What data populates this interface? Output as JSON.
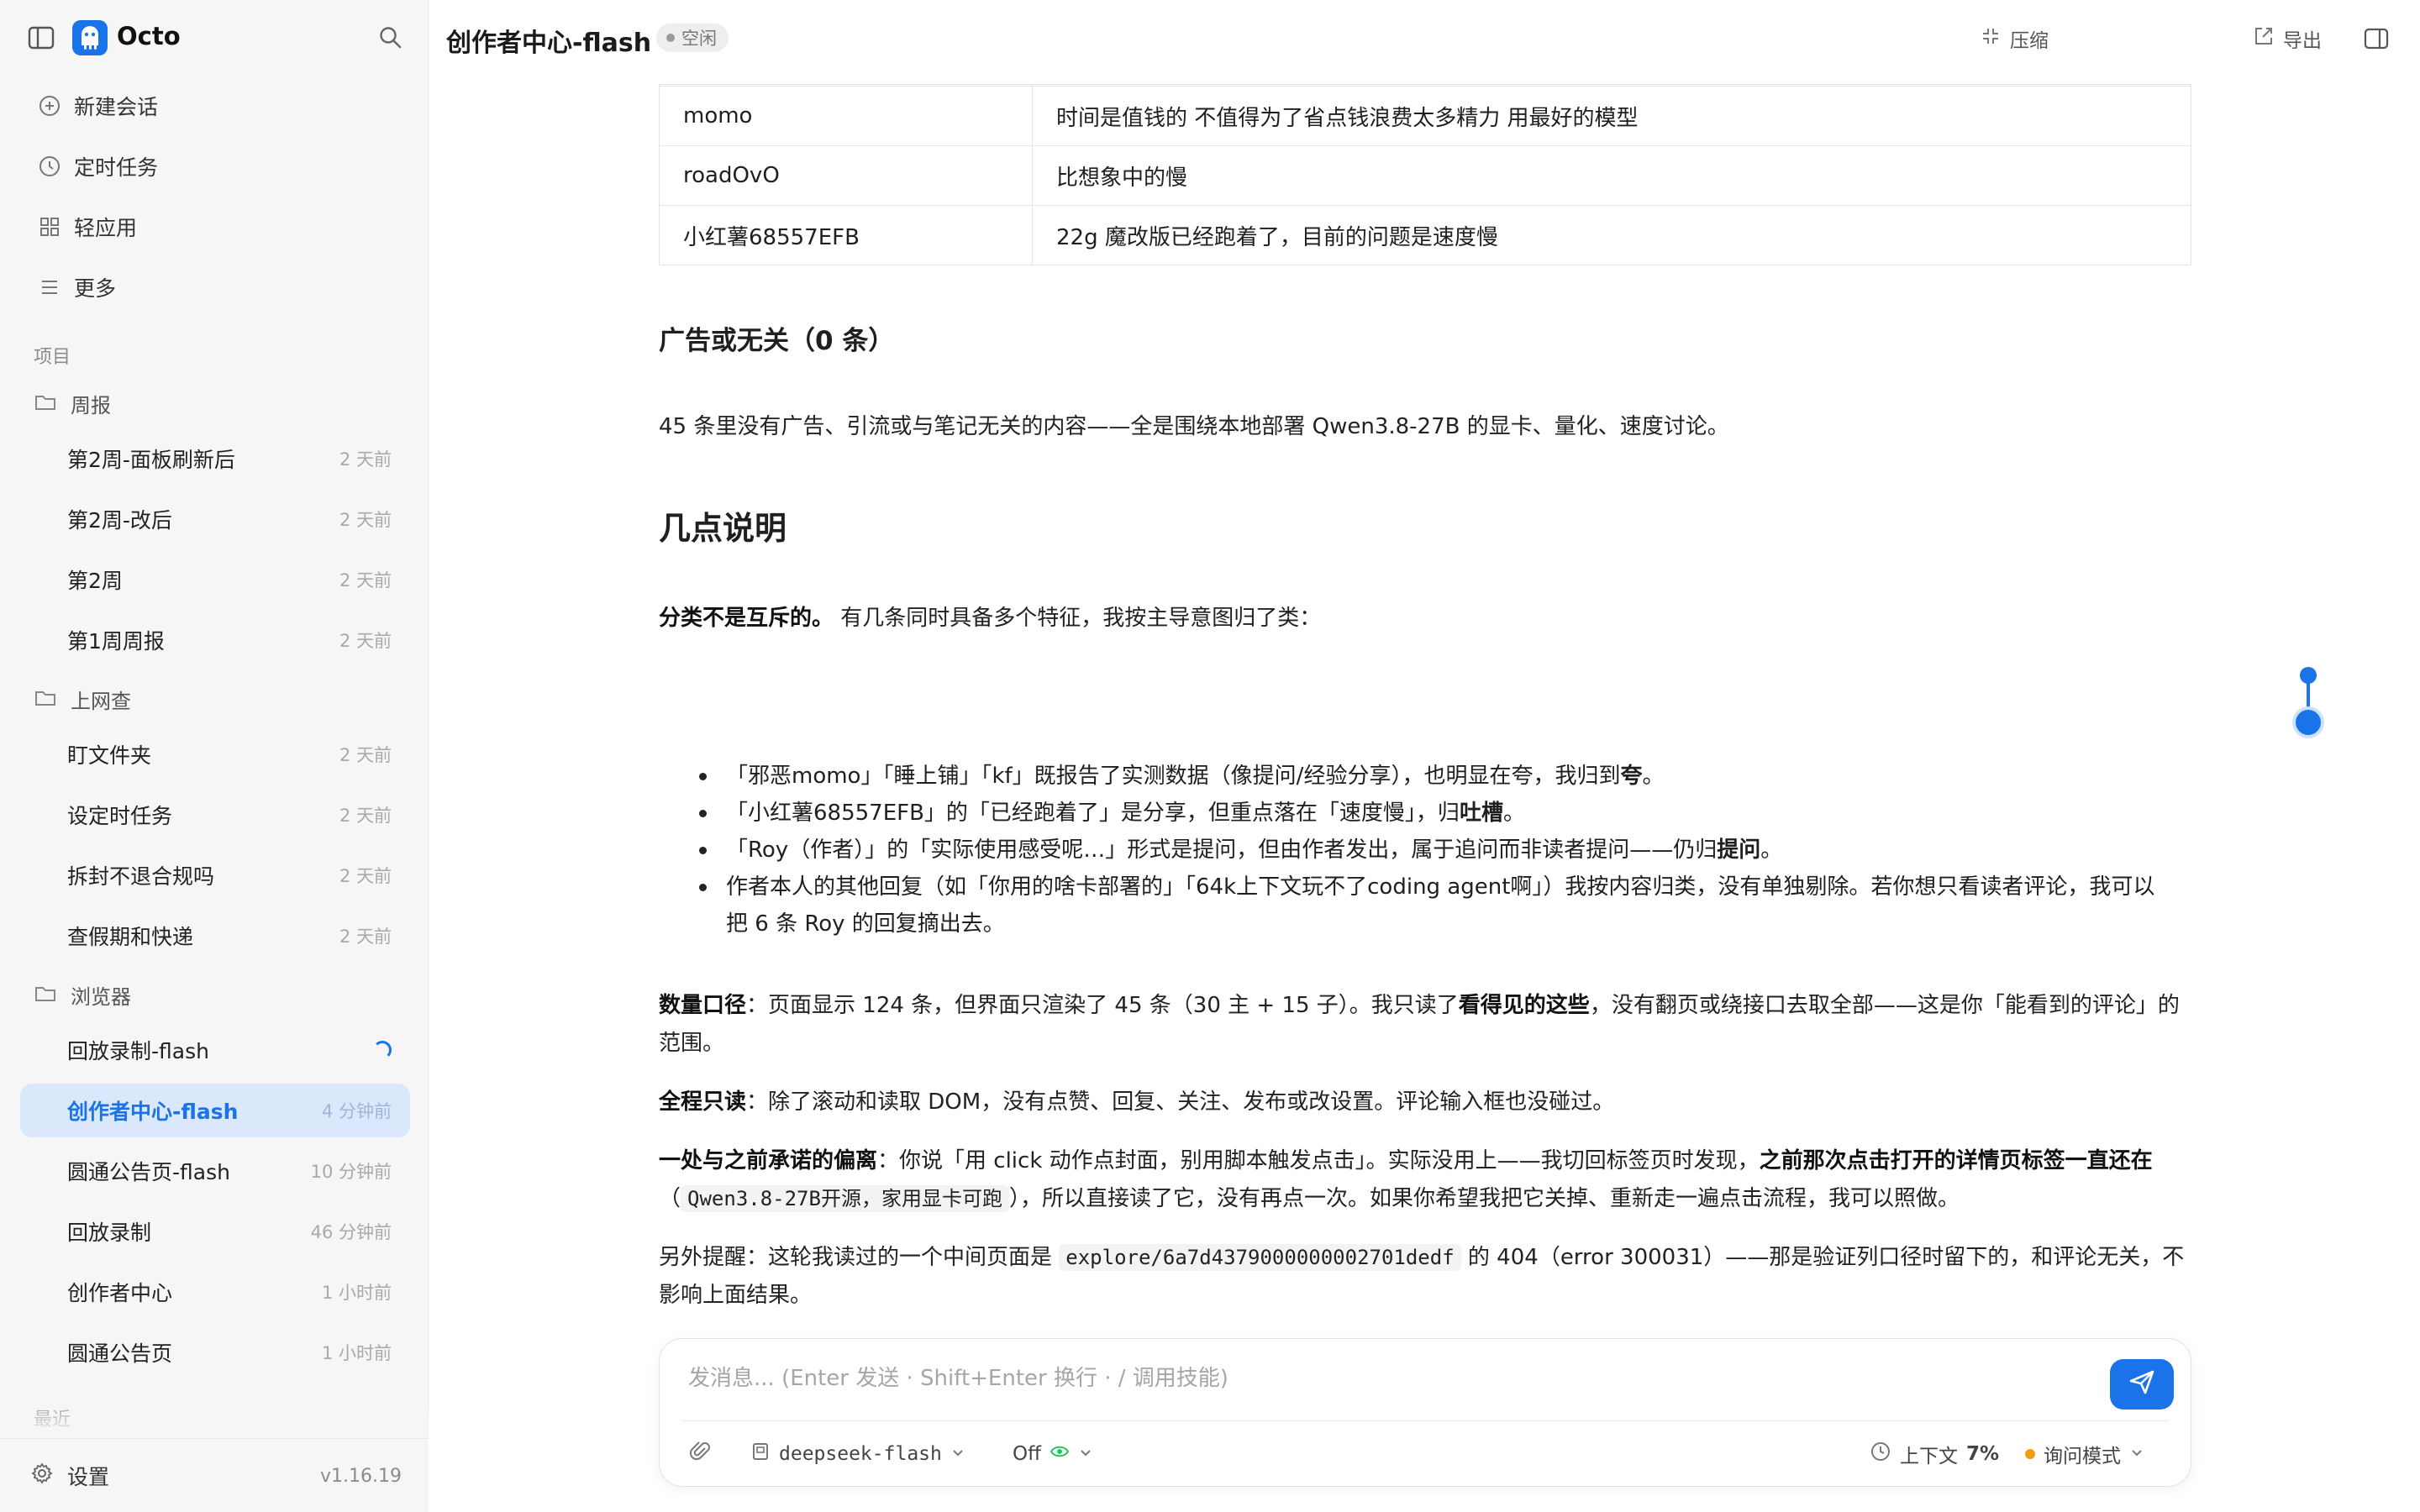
{
  "app": {
    "name": "Octo",
    "version": "v1.16.19"
  },
  "nav": [
    {
      "label": "新建会话",
      "icon": "plus-circle-icon"
    },
    {
      "label": "定时任务",
      "icon": "clock-icon"
    },
    {
      "label": "轻应用",
      "icon": "grid-icon"
    },
    {
      "label": "更多",
      "icon": "menu-icon"
    }
  ],
  "sidebar": {
    "section_label": "项目",
    "groups": [
      {
        "name": "周报",
        "sessions": [
          {
            "title": "第2周-面板刷新后",
            "time": "2 天前"
          },
          {
            "title": "第2周-改后",
            "time": "2 天前"
          },
          {
            "title": "第2周",
            "time": "2 天前"
          },
          {
            "title": "第1周周报",
            "time": "2 天前"
          }
        ]
      },
      {
        "name": "上网查",
        "sessions": [
          {
            "title": "盯文件夹",
            "time": "2 天前"
          },
          {
            "title": "设定时任务",
            "time": "2 天前"
          },
          {
            "title": "拆封不退合规吗",
            "time": "2 天前"
          },
          {
            "title": "查假期和快递",
            "time": "2 天前"
          }
        ]
      },
      {
        "name": "浏览器",
        "sessions": [
          {
            "title": "回放录制-flash",
            "time": ""
          },
          {
            "title": "创作者中心-flash",
            "time": "4 分钟前"
          },
          {
            "title": "圆通公告页-flash",
            "time": "10 分钟前"
          },
          {
            "title": "回放录制",
            "time": "46 分钟前"
          },
          {
            "title": "创作者中心",
            "time": "1 小时前"
          },
          {
            "title": "圆通公告页",
            "time": "1 小时前"
          }
        ]
      }
    ],
    "next_section_partial": "最近",
    "settings_label": "设置"
  },
  "header": {
    "title": "创作者中心-flash",
    "status": "空闲",
    "compress_label": "压缩",
    "export_label": "导出"
  },
  "content": {
    "table_rows": [
      {
        "user": "momo",
        "comment": "时间是值钱的 不值得为了省点钱浪费太多精力 用最好的模型"
      },
      {
        "user": "roadOvO",
        "comment": "比想象中的慢"
      },
      {
        "user": "小红薯68557EFB",
        "comment": "22g 魔改版已经跑着了，目前的问题是速度慢"
      }
    ],
    "ads_heading": "广告或无关（0 条）",
    "ads_text": "45 条里没有广告、引流或与笔记无关的内容——全是围绕本地部署 Qwen3.8-27B 的显卡、量化、速度讨论。",
    "notes_heading": "几点说明",
    "p1_bold": "分类不是互斥的。",
    "p1_text": "有几条同时具备多个特征，我按主导意图归了类：",
    "bullets": [
      {
        "pre": "「邪恶momo」「睡上铺」「kf」既报告了实测数据（像提问/经验分享），也明显在夸，我归到",
        "bold": "夸",
        "post": "。"
      },
      {
        "pre": "「小红薯68557EFB」的「已经跑着了」是分享，但重点落在「速度慢」，归",
        "bold": "吐槽",
        "post": "。"
      },
      {
        "pre": "「Roy（作者）」的「实际使用感受呢…」形式是提问，但由作者发出，属于追问而非读者提问——仍归",
        "bold": "提问",
        "post": "。"
      },
      {
        "pre": "作者本人的其他回复（如「你用的啥卡部署的」「64k上下文玩不了coding agent啊」）我按内容归类，没有单独剔除。若你想只看读者评论，我可以把 6 条 Roy 的回复摘出去。",
        "bold": "",
        "post": ""
      }
    ],
    "p2_bold": "数量口径",
    "p2_a": "：页面显示 124 条，但界面只渲染了 45 条（30 主 + 15 子）。我只读了",
    "p2_bold2": "看得见的这些",
    "p2_b": "，没有翻页或绕接口去取全部——这是你「能看到的评论」的范围。",
    "p3_bold": "全程只读",
    "p3_text": "：除了滚动和读取 DOM，没有点赞、回复、关注、发布或改设置。评论输入框也没碰过。",
    "p4_bold": "一处与之前承诺的偏离",
    "p4_a": "：你说「用 click 动作点封面，别用脚本触发点击」。实际没用上——我切回标签页时发现，",
    "p4_bold2": "之前那次点击打开的详情页标签一直还在",
    "p4_b": "（",
    "p4_code": "Qwen3.8-27B开源，家用显卡可跑",
    "p4_c": "），所以直接读了它，没有再点一次。如果你希望我把它关掉、重新走一遍点击流程，我可以照做。",
    "p5_a": "另外提醒：这轮我读过的一个中间页面是",
    "p5_code": "explore/6a7d4379000000002701dedf",
    "p5_b": "的 404（error 300031）——那是验证列口径时留下的，和评论无关，不影响上面结果。"
  },
  "composer": {
    "placeholder": "发消息... (Enter 发送 · Shift+Enter 换行 · / 调用技能)",
    "model": "deepseek-flash",
    "toggle_label": "Off",
    "context_label": "上下文",
    "context_value": "7%",
    "mode_label": "询问模式"
  },
  "colors": {
    "accent": "#1a73e8",
    "active_bg": "#dbe8fb",
    "mode_dot": "#f59e0b",
    "toggle_green": "#22c55e"
  }
}
